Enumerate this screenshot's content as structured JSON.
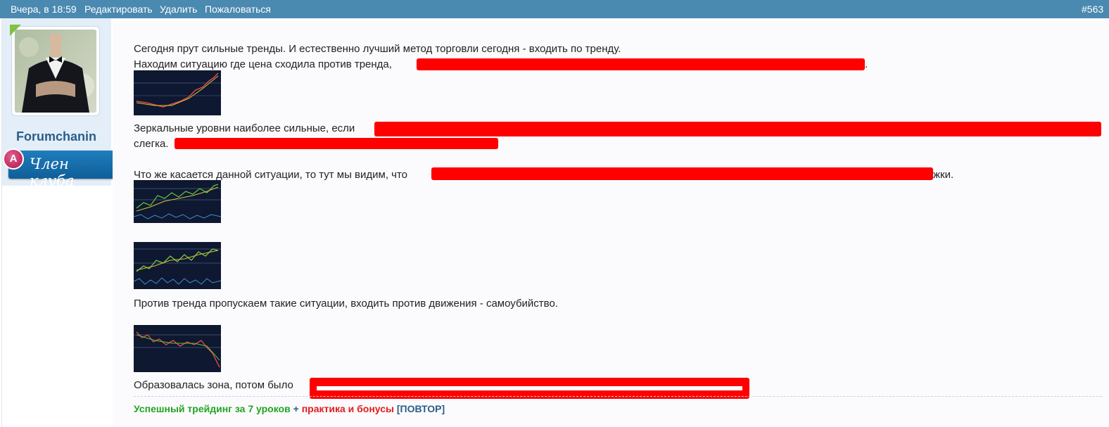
{
  "header": {
    "date": "Вчера, в 18:59",
    "edit": "Редактировать",
    "delete": "Удалить",
    "report": "Пожаловаться",
    "post_number": "#563"
  },
  "author": {
    "username": "Forumchanin",
    "rank_letter": "A",
    "rank": "Член клуба",
    "rank_color": "#1f7dbd"
  },
  "post": {
    "line1": "Сегодня прут сильные тренды. И естественно лучший метод торговли сегодня - входить по тренду.",
    "line2_start": "Находим ситуацию где цена сходила против тренда, ",
    "line2_end": ".",
    "line3_start": "Зеркальные уровни наиболее сильные, если ",
    "line4_start": "слегка. ",
    "line5_start": "Что же касается данной ситуации, то тут мы видим, что ",
    "line5_end": "жки.",
    "line6": "Против тренда пропускаем такие ситуации, входить против движения - самоубийство.",
    "line7_start": "Образовалась зона, потом было "
  },
  "signature": {
    "part1": "Успешный трейдинг за 7 уроков",
    "plus": "+",
    "part2": "практика и бонусы",
    "part3": "[ПОВТОР]"
  },
  "colors": {
    "header_bg": "#4a89b0",
    "redaction": "#ff0000",
    "chart_bg": "#0e1830"
  }
}
